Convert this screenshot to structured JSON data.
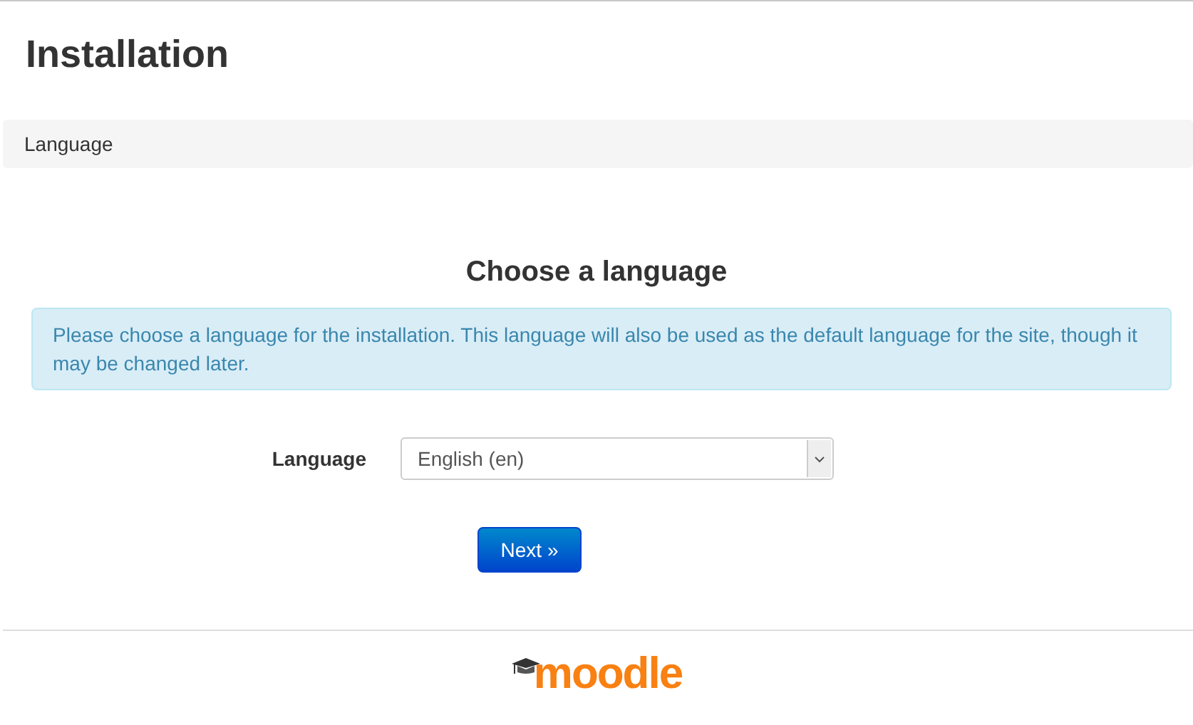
{
  "page": {
    "title": "Installation"
  },
  "breadcrumb": [
    "Language"
  ],
  "heading": "Choose a language",
  "info": "Please choose a language for the installation. This language will also be used as the default language for the site, though it may be changed later.",
  "form": {
    "label": "Language",
    "value": "English (en)"
  },
  "button": "Next »",
  "footer": {
    "logo": "moodle"
  }
}
